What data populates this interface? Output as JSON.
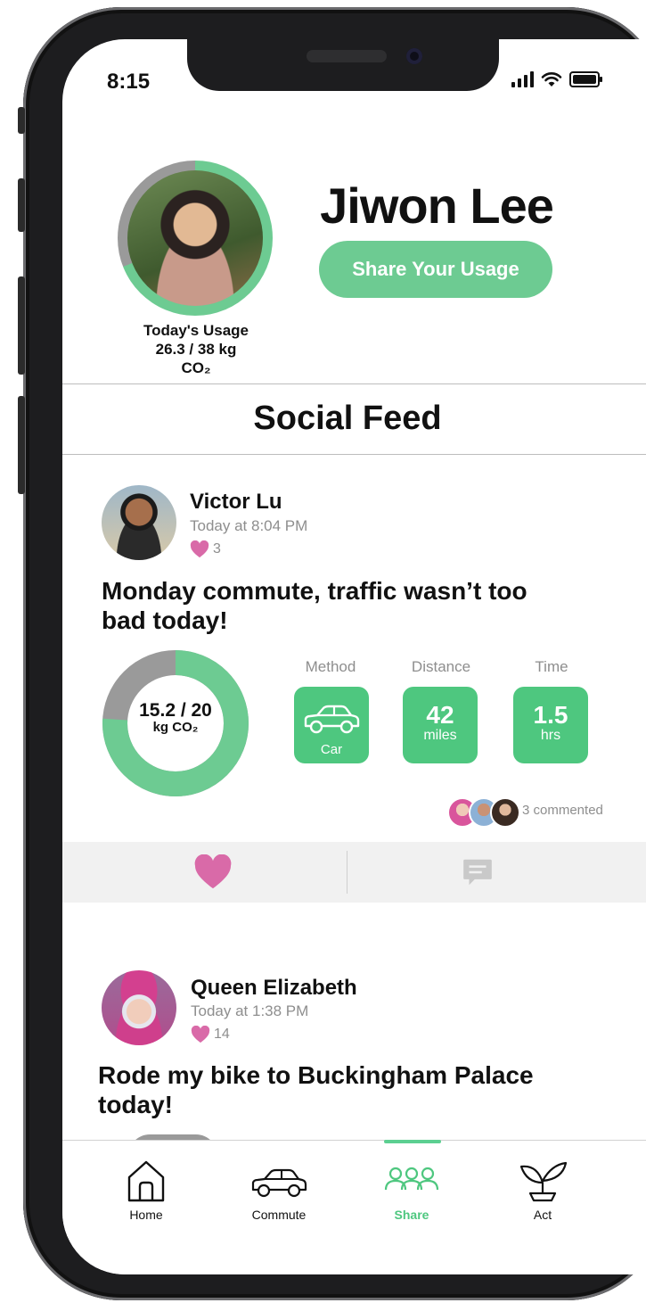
{
  "status_bar": {
    "time": "8:15"
  },
  "profile": {
    "name": "Jiwon Lee",
    "share_button": "Share Your Usage",
    "usage_label": "Today's Usage",
    "usage_value": "26.3 / 38 kg",
    "usage_unit": "CO₂",
    "usage_progress": 0.69
  },
  "feed": {
    "title": "Social Feed",
    "posts": [
      {
        "author": "Victor Lu",
        "time": "Today at 8:04 PM",
        "likes": "3",
        "text": "Monday commute, traffic wasn’t too bad today!",
        "usage": {
          "value": "15.2 / 20",
          "unit": "kg CO₂",
          "progress": 0.76
        },
        "metrics": [
          {
            "label": "Method",
            "value": "",
            "unit": "Car",
            "icon": "car-icon"
          },
          {
            "label": "Distance",
            "value": "42",
            "unit": "miles"
          },
          {
            "label": "Time",
            "value": "1.5",
            "unit": "hrs"
          }
        ],
        "comments": "3 commented"
      },
      {
        "author": "Queen Elizabeth",
        "time": "Today at 1:38 PM",
        "likes": "14",
        "text": "Rode my bike to Buckingham Palace today!"
      }
    ]
  },
  "tabs": [
    {
      "label": "Home",
      "icon": "home-icon"
    },
    {
      "label": "Commute",
      "icon": "car-icon"
    },
    {
      "label": "Share",
      "icon": "people-icon",
      "active": true
    },
    {
      "label": "Act",
      "icon": "sprout-icon"
    }
  ],
  "colors": {
    "accent": "#6dcb92",
    "metric": "#4ec77f",
    "heart": "#d96aa8",
    "ring_gray": "#9a9a9a"
  }
}
